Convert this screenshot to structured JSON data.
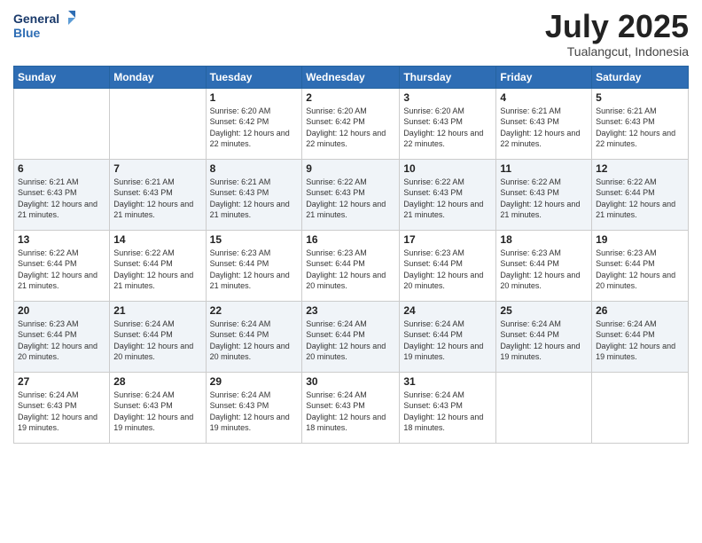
{
  "header": {
    "logo_line1": "General",
    "logo_line2": "Blue",
    "main_title": "July 2025",
    "subtitle": "Tualangcut, Indonesia"
  },
  "calendar": {
    "days_of_week": [
      "Sunday",
      "Monday",
      "Tuesday",
      "Wednesday",
      "Thursday",
      "Friday",
      "Saturday"
    ],
    "weeks": [
      [
        {
          "day": "",
          "info": ""
        },
        {
          "day": "",
          "info": ""
        },
        {
          "day": "1",
          "info": "Sunrise: 6:20 AM\nSunset: 6:42 PM\nDaylight: 12 hours and 22 minutes."
        },
        {
          "day": "2",
          "info": "Sunrise: 6:20 AM\nSunset: 6:42 PM\nDaylight: 12 hours and 22 minutes."
        },
        {
          "day": "3",
          "info": "Sunrise: 6:20 AM\nSunset: 6:43 PM\nDaylight: 12 hours and 22 minutes."
        },
        {
          "day": "4",
          "info": "Sunrise: 6:21 AM\nSunset: 6:43 PM\nDaylight: 12 hours and 22 minutes."
        },
        {
          "day": "5",
          "info": "Sunrise: 6:21 AM\nSunset: 6:43 PM\nDaylight: 12 hours and 22 minutes."
        }
      ],
      [
        {
          "day": "6",
          "info": "Sunrise: 6:21 AM\nSunset: 6:43 PM\nDaylight: 12 hours and 21 minutes."
        },
        {
          "day": "7",
          "info": "Sunrise: 6:21 AM\nSunset: 6:43 PM\nDaylight: 12 hours and 21 minutes."
        },
        {
          "day": "8",
          "info": "Sunrise: 6:21 AM\nSunset: 6:43 PM\nDaylight: 12 hours and 21 minutes."
        },
        {
          "day": "9",
          "info": "Sunrise: 6:22 AM\nSunset: 6:43 PM\nDaylight: 12 hours and 21 minutes."
        },
        {
          "day": "10",
          "info": "Sunrise: 6:22 AM\nSunset: 6:43 PM\nDaylight: 12 hours and 21 minutes."
        },
        {
          "day": "11",
          "info": "Sunrise: 6:22 AM\nSunset: 6:43 PM\nDaylight: 12 hours and 21 minutes."
        },
        {
          "day": "12",
          "info": "Sunrise: 6:22 AM\nSunset: 6:44 PM\nDaylight: 12 hours and 21 minutes."
        }
      ],
      [
        {
          "day": "13",
          "info": "Sunrise: 6:22 AM\nSunset: 6:44 PM\nDaylight: 12 hours and 21 minutes."
        },
        {
          "day": "14",
          "info": "Sunrise: 6:22 AM\nSunset: 6:44 PM\nDaylight: 12 hours and 21 minutes."
        },
        {
          "day": "15",
          "info": "Sunrise: 6:23 AM\nSunset: 6:44 PM\nDaylight: 12 hours and 21 minutes."
        },
        {
          "day": "16",
          "info": "Sunrise: 6:23 AM\nSunset: 6:44 PM\nDaylight: 12 hours and 20 minutes."
        },
        {
          "day": "17",
          "info": "Sunrise: 6:23 AM\nSunset: 6:44 PM\nDaylight: 12 hours and 20 minutes."
        },
        {
          "day": "18",
          "info": "Sunrise: 6:23 AM\nSunset: 6:44 PM\nDaylight: 12 hours and 20 minutes."
        },
        {
          "day": "19",
          "info": "Sunrise: 6:23 AM\nSunset: 6:44 PM\nDaylight: 12 hours and 20 minutes."
        }
      ],
      [
        {
          "day": "20",
          "info": "Sunrise: 6:23 AM\nSunset: 6:44 PM\nDaylight: 12 hours and 20 minutes."
        },
        {
          "day": "21",
          "info": "Sunrise: 6:24 AM\nSunset: 6:44 PM\nDaylight: 12 hours and 20 minutes."
        },
        {
          "day": "22",
          "info": "Sunrise: 6:24 AM\nSunset: 6:44 PM\nDaylight: 12 hours and 20 minutes."
        },
        {
          "day": "23",
          "info": "Sunrise: 6:24 AM\nSunset: 6:44 PM\nDaylight: 12 hours and 20 minutes."
        },
        {
          "day": "24",
          "info": "Sunrise: 6:24 AM\nSunset: 6:44 PM\nDaylight: 12 hours and 19 minutes."
        },
        {
          "day": "25",
          "info": "Sunrise: 6:24 AM\nSunset: 6:44 PM\nDaylight: 12 hours and 19 minutes."
        },
        {
          "day": "26",
          "info": "Sunrise: 6:24 AM\nSunset: 6:44 PM\nDaylight: 12 hours and 19 minutes."
        }
      ],
      [
        {
          "day": "27",
          "info": "Sunrise: 6:24 AM\nSunset: 6:43 PM\nDaylight: 12 hours and 19 minutes."
        },
        {
          "day": "28",
          "info": "Sunrise: 6:24 AM\nSunset: 6:43 PM\nDaylight: 12 hours and 19 minutes."
        },
        {
          "day": "29",
          "info": "Sunrise: 6:24 AM\nSunset: 6:43 PM\nDaylight: 12 hours and 19 minutes."
        },
        {
          "day": "30",
          "info": "Sunrise: 6:24 AM\nSunset: 6:43 PM\nDaylight: 12 hours and 18 minutes."
        },
        {
          "day": "31",
          "info": "Sunrise: 6:24 AM\nSunset: 6:43 PM\nDaylight: 12 hours and 18 minutes."
        },
        {
          "day": "",
          "info": ""
        },
        {
          "day": "",
          "info": ""
        }
      ]
    ]
  }
}
